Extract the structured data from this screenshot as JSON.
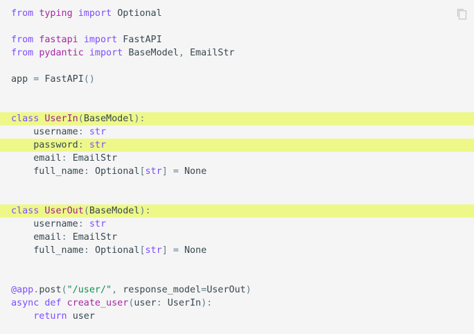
{
  "code": {
    "line1": {
      "t1": "from",
      "t2": "typing",
      "t3": "import",
      "t4": "Optional"
    },
    "line3": {
      "t1": "from",
      "t2": "fastapi",
      "t3": "import",
      "t4": "FastAPI"
    },
    "line4": {
      "t1": "from",
      "t2": "pydantic",
      "t3": "import",
      "t4": "BaseModel",
      "t5": ",",
      "t6": "EmailStr"
    },
    "line6": {
      "t1": "app",
      "t2": "=",
      "t3": "FastAPI",
      "t4": "()"
    },
    "line9": {
      "t1": "class",
      "t2": "UserIn",
      "t3": "(",
      "t4": "BaseModel",
      "t5": "):"
    },
    "line10": {
      "t1": "username",
      "t2": ":",
      "t3": "str"
    },
    "line11": {
      "t1": "password",
      "t2": ":",
      "t3": "str"
    },
    "line12": {
      "t1": "email",
      "t2": ":",
      "t3": "EmailStr"
    },
    "line13": {
      "t1": "full_name",
      "t2": ":",
      "t3": "Optional",
      "t4": "[",
      "t5": "str",
      "t6": "]",
      "t7": "=",
      "t8": "None"
    },
    "line16": {
      "t1": "class",
      "t2": "UserOut",
      "t3": "(",
      "t4": "BaseModel",
      "t5": "):"
    },
    "line17": {
      "t1": "username",
      "t2": ":",
      "t3": "str"
    },
    "line18": {
      "t1": "email",
      "t2": ":",
      "t3": "EmailStr"
    },
    "line19": {
      "t1": "full_name",
      "t2": ":",
      "t3": "Optional",
      "t4": "[",
      "t5": "str",
      "t6": "]",
      "t7": "=",
      "t8": "None"
    },
    "line22": {
      "t1": "@app",
      "t2": ".",
      "t3": "post",
      "t4": "(",
      "t5": "\"/user/\"",
      "t6": ",",
      "t7": "response_model",
      "t8": "=",
      "t9": "UserOut",
      "t10": ")"
    },
    "line23": {
      "t1": "async",
      "t2": "def",
      "t3": "create_user",
      "t4": "(",
      "t5": "user",
      "t6": ":",
      "t7": "UserIn",
      "t8": "):"
    },
    "line24": {
      "t1": "return",
      "t2": "user"
    }
  },
  "highlighted_lines": [
    9,
    11,
    16
  ],
  "copy_icon": "copy-icon",
  "colors": {
    "highlight": "#eef889",
    "background": "#f5f5f5"
  }
}
